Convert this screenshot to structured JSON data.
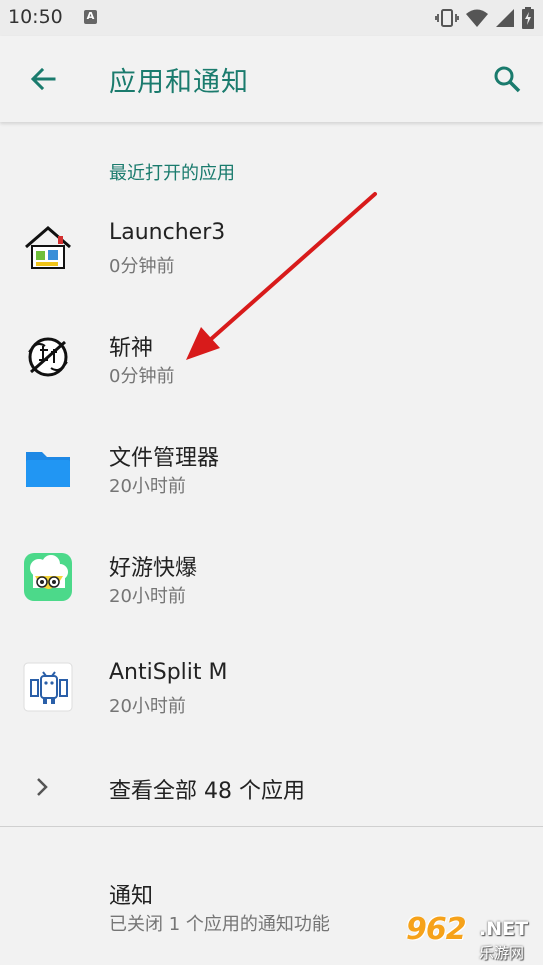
{
  "status_bar": {
    "time": "10:50",
    "notification_badge": "A",
    "icons": [
      "vibrate-icon",
      "wifi-icon",
      "signal-icon",
      "battery-icon"
    ]
  },
  "app_bar": {
    "back_icon": "arrow-back-icon",
    "title": "应用和通知",
    "search_icon": "search-icon"
  },
  "recent_section": {
    "header": "最近打开的应用",
    "apps": [
      {
        "name": "Launcher3",
        "time": "0分钟前",
        "icon": "launcher3-icon"
      },
      {
        "name": "斩神",
        "time": "0分钟前",
        "icon": "zhanshen-icon"
      },
      {
        "name": "文件管理器",
        "time": "20小时前",
        "icon": "folder-icon"
      },
      {
        "name": "好游快爆",
        "time": "20小时前",
        "icon": "haoyoukuaibao-icon"
      },
      {
        "name": "AntiSplit M",
        "time": "20小时前",
        "icon": "antisplit-icon"
      }
    ]
  },
  "view_all": {
    "label": "查看全部 48 个应用",
    "icon": "chevron-right-icon"
  },
  "notifications": {
    "label": "通知",
    "subtitle": "已关闭 1 个应用的通知功能"
  },
  "watermark": {
    "big": "962",
    "net": ".NET",
    "cn": "乐游网"
  },
  "colors": {
    "accent": "#1a7b6d",
    "background": "#f2f2f2",
    "arrow": "#d81b1b",
    "folder": "#2196f3"
  }
}
